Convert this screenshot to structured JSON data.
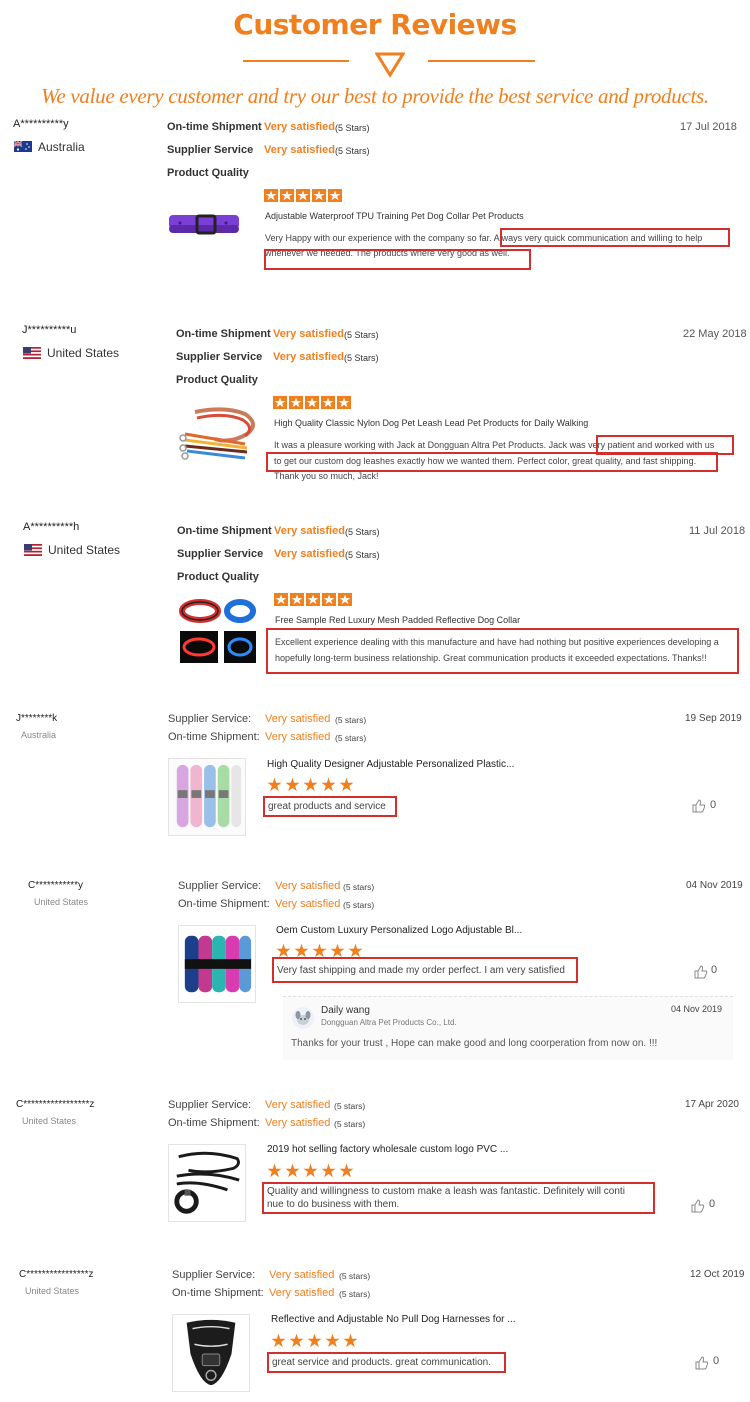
{
  "header": {
    "title": "Customer Reviews",
    "tagline": "We value every customer and try our best to provide the best service and products."
  },
  "reviews_a": [
    {
      "user": "A**********y",
      "country": "Australia",
      "labels": [
        "On-time Shipment",
        "Supplier Service",
        "Product Quality"
      ],
      "ratings": [
        "Very satisfied",
        "Very satisfied"
      ],
      "stars_note": "(5 Stars)",
      "date": "17 Jul 2018",
      "product": "Adjustable Waterproof TPU Training Pet Dog Collar Pet Products",
      "text_line1": "Very Happy with our experience with the company so far. Always very quick communication and willing to help",
      "text_line2": "whenever we needed. The products where very good as well."
    },
    {
      "user": "J**********u",
      "country": "United States",
      "labels": [
        "On-time Shipment",
        "Supplier Service",
        "Product Quality"
      ],
      "ratings": [
        "Very satisfied",
        "Very satisfied"
      ],
      "stars_note": "(5 Stars)",
      "date": "22 May 2018",
      "product": "High Quality Classic Nylon Dog Pet Leash Lead Pet Products for Daily Walking",
      "text_line1": "It was a pleasure working with Jack at Dongguan Altra Pet Products. Jack was very patient and worked with us",
      "text_line2": "to get our custom dog leashes exactly how we wanted them. Perfect color, great quality, and fast shipping.",
      "text_line3": "Thank you so much, Jack!"
    },
    {
      "user": "A**********h",
      "country": "United States",
      "labels": [
        "On-time Shipment",
        "Supplier Service",
        "Product Quality"
      ],
      "ratings": [
        "Very satisfied",
        "Very satisfied"
      ],
      "stars_note": "(5 Stars)",
      "date": "11 Jul 2018",
      "product": "Free Sample Red Luxury Mesh Padded Reflective Dog Collar",
      "text_line1": "Excellent experience dealing with this manufacture and have had nothing but positive experiences developing a",
      "text_line2": "hopefully long-term business relationship. Great communication products it exceeded expectations. Thanks!!"
    }
  ],
  "reviews_b": [
    {
      "user": "J********k",
      "country": "Australia",
      "labels": [
        "Supplier Service:",
        "On-time Shipment:"
      ],
      "ratings": [
        "Very satisfied",
        "Very satisfied"
      ],
      "stars_note": "(5 stars)",
      "date": "19 Sep 2019",
      "product": "High Quality Designer Adjustable Personalized Plastic...",
      "text": "great products and service",
      "likes": "0"
    },
    {
      "user": "C***********y",
      "country": "United States",
      "labels": [
        "Supplier Service:",
        "On-time Shipment:"
      ],
      "ratings": [
        "Very satisfied",
        "Very satisfied"
      ],
      "stars_note": "(5 stars)",
      "date": "04 Nov 2019",
      "product": "Oem Custom Luxury Personalized Logo Adjustable Bl...",
      "text": "Very fast shipping and made my order perfect. I am very satisfied",
      "likes": "0",
      "reply": {
        "name": "Daily wang",
        "company": "Dongguan Altra Pet Products Co., Ltd.",
        "date": "04 Nov 2019",
        "text": "Thanks for your trust , Hope can make good and long coorperation from now on. !!!"
      }
    },
    {
      "user": "C*****************z",
      "country": "United States",
      "labels": [
        "Supplier Service:",
        "On-time Shipment:"
      ],
      "ratings": [
        "Very satisfied",
        "Very satisfied"
      ],
      "stars_note": "(5 stars)",
      "date": "17 Apr 2020",
      "product": "2019 hot selling factory wholesale custom logo PVC ...",
      "text_line1": "Quality and willingness to custom make a leash was fantastic. Definitely will conti",
      "text_line2": "nue to do business with them.",
      "likes": "0"
    },
    {
      "user": "C****************z",
      "country": "United States",
      "labels": [
        "Supplier Service:",
        "On-time Shipment:"
      ],
      "ratings": [
        "Very satisfied",
        "Very satisfied"
      ],
      "stars_note": "(5 stars)",
      "date": "12 Oct 2019",
      "product": "Reflective and Adjustable No Pull Dog Harnesses for ...",
      "text": "great service and products. great communication.",
      "likes": "0"
    }
  ],
  "colors": {
    "accent": "#f07f1e",
    "highlight_box": "#d32f2f"
  }
}
